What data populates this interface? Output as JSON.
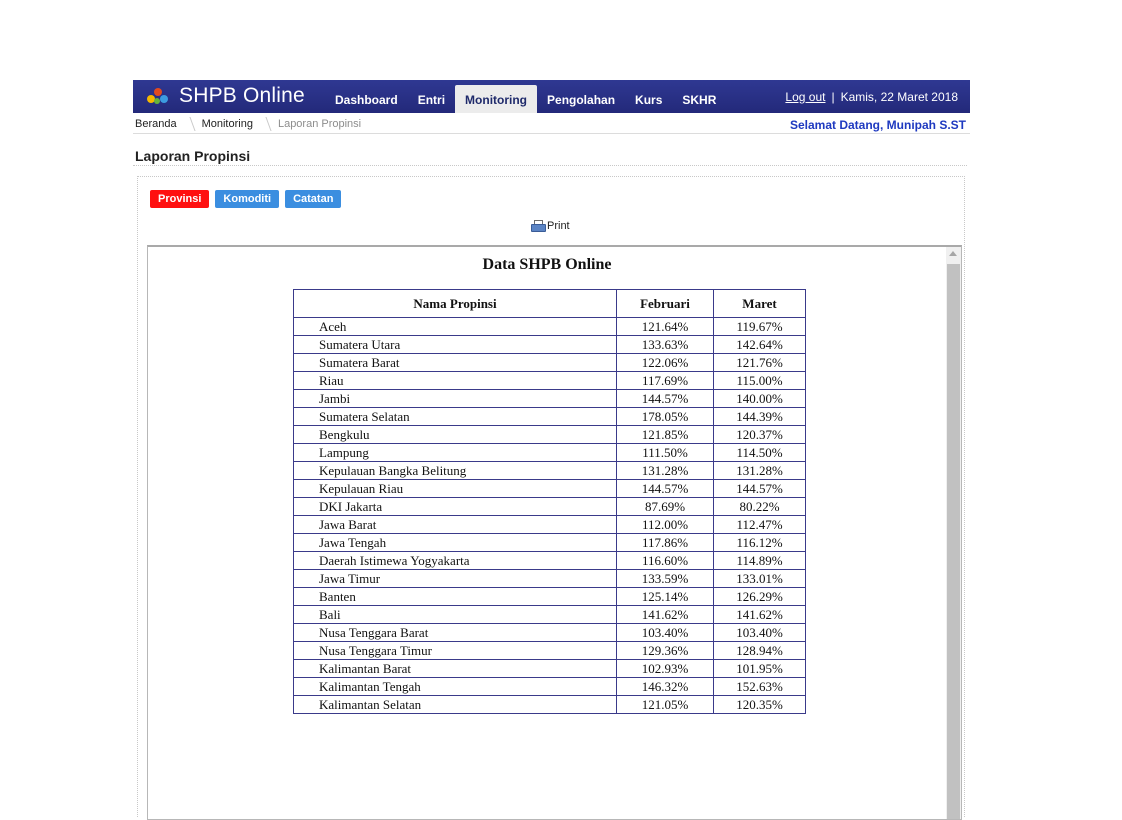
{
  "header": {
    "app_title": "SHPB Online",
    "nav": [
      {
        "label": "Dashboard",
        "active": false
      },
      {
        "label": "Entri",
        "active": false
      },
      {
        "label": "Monitoring",
        "active": true
      },
      {
        "label": "Pengolahan",
        "active": false
      },
      {
        "label": "Kurs",
        "active": false
      },
      {
        "label": "SKHR",
        "active": false
      }
    ],
    "logout": "Log out",
    "separator": "|",
    "date": "Kamis, 22 Maret 2018"
  },
  "breadcrumb": {
    "items": [
      "Beranda",
      "Monitoring",
      "Laporan Propinsi"
    ]
  },
  "welcome": "Selamat Datang, Munipah S.ST",
  "page_title": "Laporan Propinsi",
  "tabs": [
    {
      "label": "Provinsi",
      "active": true
    },
    {
      "label": "Komoditi",
      "active": false
    },
    {
      "label": "Catatan",
      "active": false
    }
  ],
  "print_label": "Print",
  "report": {
    "title": "Data SHPB Online",
    "columns": [
      "Nama Propinsi",
      "Februari",
      "Maret"
    ],
    "rows": [
      [
        "Aceh",
        "121.64%",
        "119.67%"
      ],
      [
        "Sumatera Utara",
        "133.63%",
        "142.64%"
      ],
      [
        "Sumatera Barat",
        "122.06%",
        "121.76%"
      ],
      [
        "Riau",
        "117.69%",
        "115.00%"
      ],
      [
        "Jambi",
        "144.57%",
        "140.00%"
      ],
      [
        "Sumatera Selatan",
        "178.05%",
        "144.39%"
      ],
      [
        "Bengkulu",
        "121.85%",
        "120.37%"
      ],
      [
        "Lampung",
        "111.50%",
        "114.50%"
      ],
      [
        "Kepulauan Bangka Belitung",
        "131.28%",
        "131.28%"
      ],
      [
        "Kepulauan Riau",
        "144.57%",
        "144.57%"
      ],
      [
        "DKI Jakarta",
        "87.69%",
        "80.22%"
      ],
      [
        "Jawa Barat",
        "112.00%",
        "112.47%"
      ],
      [
        "Jawa Tengah",
        "117.86%",
        "116.12%"
      ],
      [
        "Daerah Istimewa Yogyakarta",
        "116.60%",
        "114.89%"
      ],
      [
        "Jawa Timur",
        "133.59%",
        "133.01%"
      ],
      [
        "Banten",
        "125.14%",
        "126.29%"
      ],
      [
        "Bali",
        "141.62%",
        "141.62%"
      ],
      [
        "Nusa Tenggara Barat",
        "103.40%",
        "103.40%"
      ],
      [
        "Nusa Tenggara Timur",
        "129.36%",
        "128.94%"
      ],
      [
        "Kalimantan Barat",
        "102.93%",
        "101.95%"
      ],
      [
        "Kalimantan Tengah",
        "146.32%",
        "152.63%"
      ],
      [
        "Kalimantan Selatan",
        "121.05%",
        "120.35%"
      ]
    ]
  }
}
